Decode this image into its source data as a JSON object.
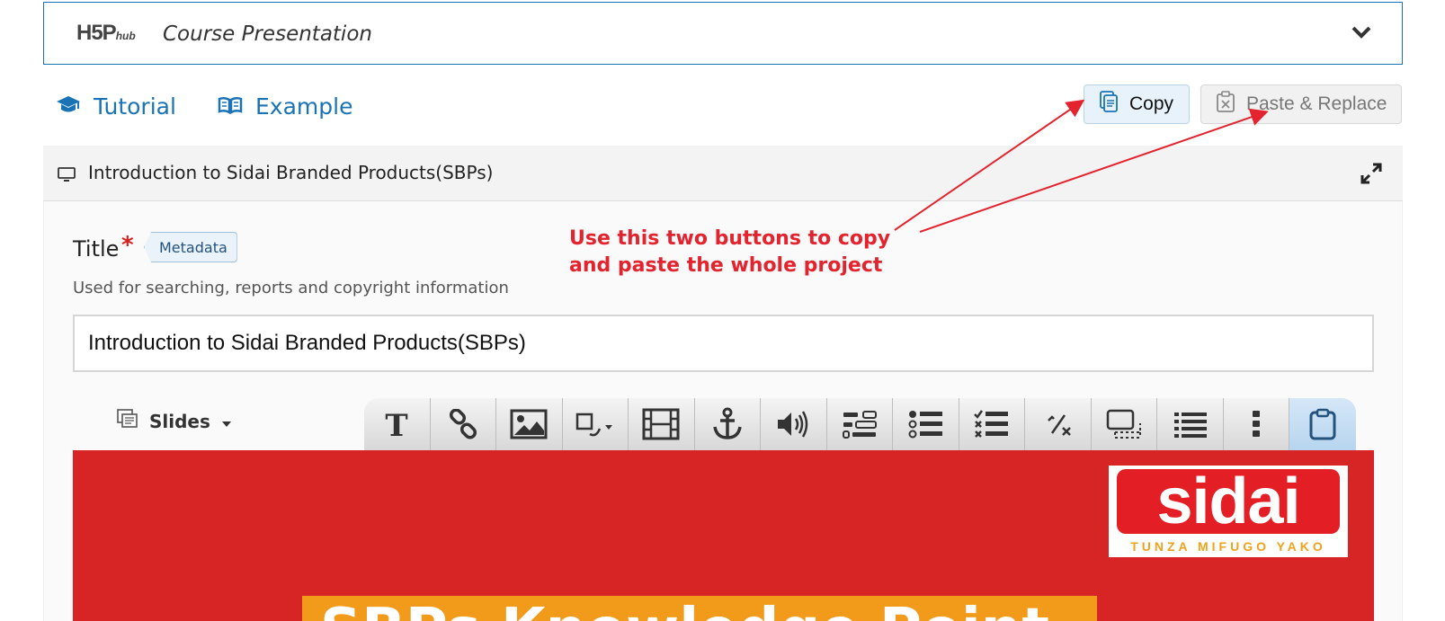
{
  "hub": {
    "logo_main": "H5P",
    "logo_sub": "hub",
    "content_type": "Course Presentation"
  },
  "links": {
    "tutorial": "Tutorial",
    "example": "Example"
  },
  "actions": {
    "copy": "Copy",
    "paste_replace": "Paste & Replace"
  },
  "panel": {
    "title": "Introduction to Sidai Branded Products(SBPs)"
  },
  "form": {
    "title_label": "Title",
    "required_mark": "*",
    "metadata_button": "Metadata",
    "title_description": "Used for searching, reports and copyright information",
    "title_value": "Introduction to Sidai Branded Products(SBPs)"
  },
  "annotation": {
    "text": "Use this two buttons to copy\nand paste the whole project",
    "color": "#e3232d"
  },
  "editor": {
    "slides_label": "Slides",
    "tools": [
      "text-icon",
      "link-icon",
      "image-icon",
      "shapes-icon",
      "video-icon",
      "anchor-icon",
      "audio-icon",
      "fill-in-blanks-icon",
      "single-choice-icon",
      "multiple-choice-icon",
      "fraction-icon",
      "hotspot-icon",
      "summary-icon",
      "more-icon",
      "paste-icon"
    ]
  },
  "slide": {
    "logo_word": "sidai",
    "logo_tagline": "TUNZA MIFUGO YAKO",
    "heading": "SBPs Knowledge Point"
  },
  "colors": {
    "accent": "#1a73b5",
    "slide_bg": "#d72424",
    "heading_bg": "#f29a1a"
  }
}
